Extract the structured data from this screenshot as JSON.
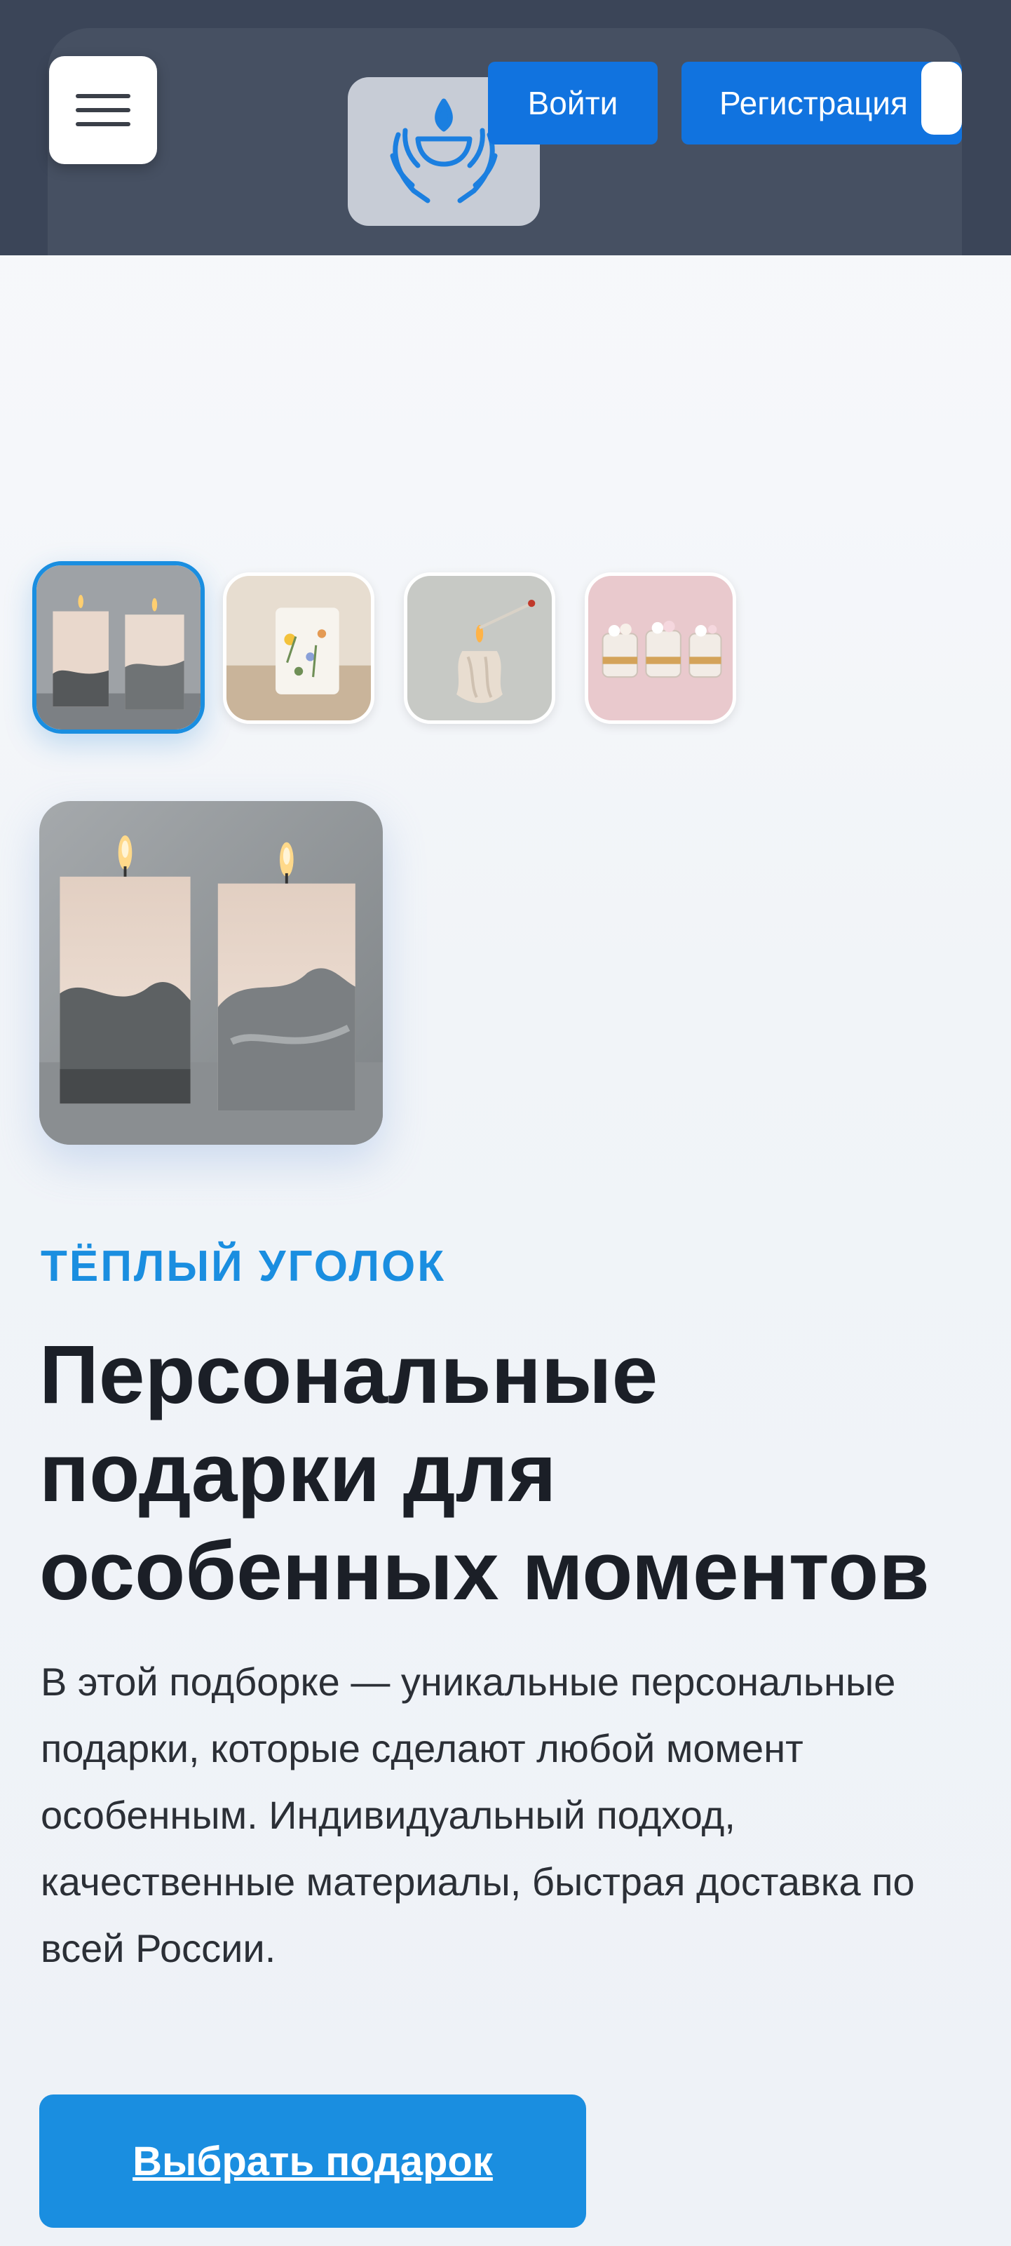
{
  "header": {
    "menu_icon": "hamburger-menu-icon",
    "logo_icon": "candle-in-hands-icon",
    "login_label": "Войти",
    "register_label": "Регистрация"
  },
  "gallery": {
    "thumbnails": [
      {
        "name": "two-concrete-candles",
        "active": true
      },
      {
        "name": "floral-pillar-candle",
        "active": false
      },
      {
        "name": "sculpted-candle-lit-match",
        "active": false
      },
      {
        "name": "three-jar-candles",
        "active": false
      }
    ],
    "main_image": "two-concrete-candles"
  },
  "hero": {
    "eyebrow": "ТЁПЛЫЙ УГОЛОК",
    "title": "Персональные подарки для особенных моментов",
    "description": "В этой подборке — уникальные персональные подарки, которые сделают любой момент особенным. Индивидуальный подход, качественные материалы, быстрая доставка по всей России.",
    "cta_label": "Выбрать подарок"
  },
  "colors": {
    "header_bg": "#3b4558",
    "primary_button": "#1173df",
    "accent": "#1a8ee0",
    "text": "#1b1f27"
  }
}
